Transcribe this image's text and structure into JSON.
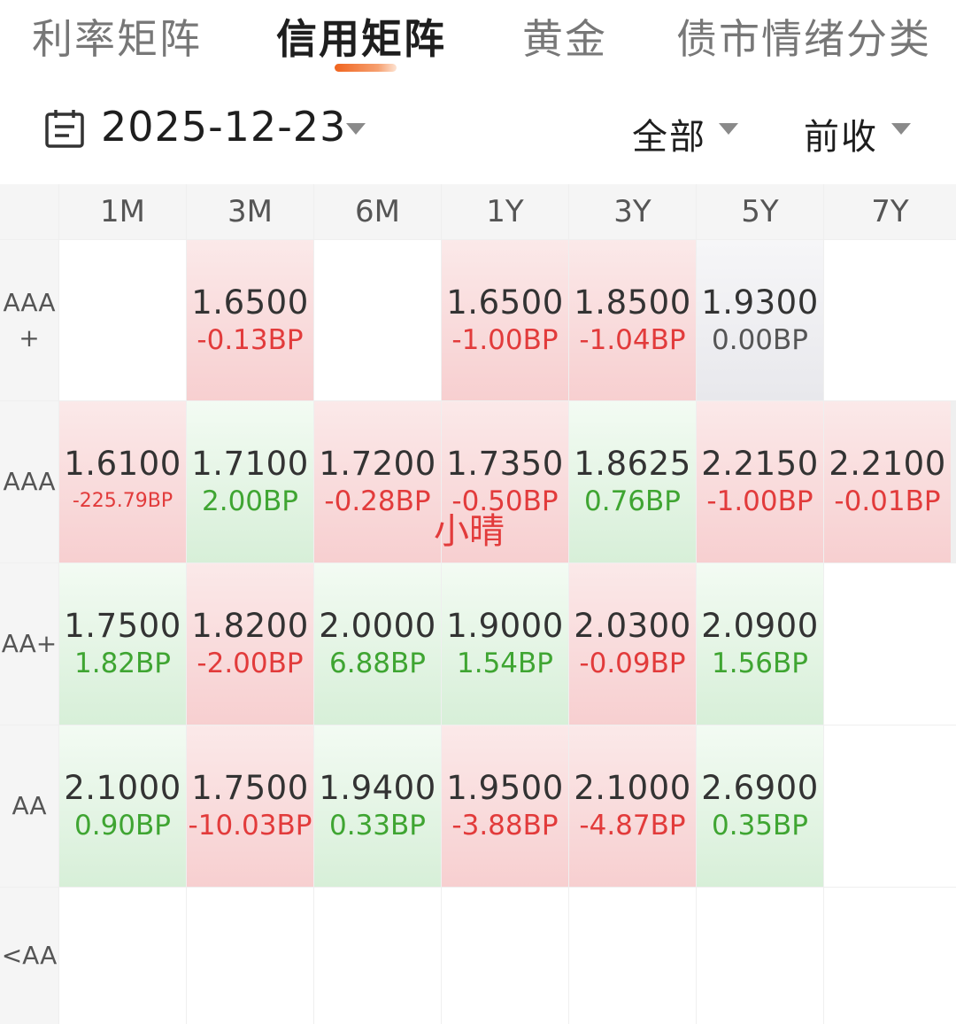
{
  "tabs": [
    {
      "label": "利率矩阵",
      "active": false
    },
    {
      "label": "信用矩阵",
      "active": true
    },
    {
      "label": "黄金",
      "active": false
    },
    {
      "label": "债市情绪分类",
      "active": false
    }
  ],
  "filters": {
    "date": "2025-12-23",
    "scope": "全部",
    "basis": "前收"
  },
  "matrix": {
    "columns": [
      "1M",
      "3M",
      "6M",
      "1Y",
      "3Y",
      "5Y",
      "7Y"
    ],
    "rows": [
      {
        "label": "AAA +",
        "cells": [
          null,
          {
            "value": "1.6500",
            "change": "-0.13BP",
            "trend": "up"
          },
          null,
          {
            "value": "1.6500",
            "change": "-1.00BP",
            "trend": "up"
          },
          {
            "value": "1.8500",
            "change": "-1.04BP",
            "trend": "up"
          },
          {
            "value": "1.9300",
            "change": "0.00BP",
            "trend": "flat"
          },
          null
        ]
      },
      {
        "label": "AAA",
        "cells": [
          {
            "value": "1.6100",
            "change": "-225.79BP",
            "trend": "up"
          },
          {
            "value": "1.7100",
            "change": "2.00BP",
            "trend": "down"
          },
          {
            "value": "1.7200",
            "change": "-0.28BP",
            "trend": "up"
          },
          {
            "value": "1.7350",
            "change": "-0.50BP",
            "trend": "up"
          },
          {
            "value": "1.8625",
            "change": "0.76BP",
            "trend": "down"
          },
          {
            "value": "2.2150",
            "change": "-1.00BP",
            "trend": "up"
          },
          {
            "value": "2.2100",
            "change": "-0.01BP",
            "trend": "up"
          }
        ]
      },
      {
        "label": "AA+",
        "cells": [
          {
            "value": "1.7500",
            "change": "1.82BP",
            "trend": "down"
          },
          {
            "value": "1.8200",
            "change": "-2.00BP",
            "trend": "up"
          },
          {
            "value": "2.0000",
            "change": "6.88BP",
            "trend": "down"
          },
          {
            "value": "1.9000",
            "change": "1.54BP",
            "trend": "down"
          },
          {
            "value": "2.0300",
            "change": "-0.09BP",
            "trend": "up"
          },
          {
            "value": "2.0900",
            "change": "1.56BP",
            "trend": "down"
          },
          null
        ]
      },
      {
        "label": "AA",
        "cells": [
          {
            "value": "2.1000",
            "change": "0.90BP",
            "trend": "down"
          },
          {
            "value": "1.7500",
            "change": "-10.03BP",
            "trend": "up"
          },
          {
            "value": "1.9400",
            "change": "0.33BP",
            "trend": "down"
          },
          {
            "value": "1.9500",
            "change": "-3.88BP",
            "trend": "up"
          },
          {
            "value": "2.1000",
            "change": "-4.87BP",
            "trend": "up"
          },
          {
            "value": "2.6900",
            "change": "0.35BP",
            "trend": "down"
          },
          null
        ]
      },
      {
        "label": "<AA",
        "cells": [
          null,
          null,
          null,
          null,
          null,
          null,
          null
        ]
      }
    ]
  },
  "watermark": "小晴",
  "icons": {
    "date_picker": "calendar-icon",
    "dropdown": "caret-down-icon"
  },
  "colors": {
    "accent": "#f0641e",
    "rise_text": "#e23b3b",
    "fall_text": "#3fa532",
    "rise_bg": "#f7cfd0",
    "fall_bg": "#d7efd8"
  }
}
